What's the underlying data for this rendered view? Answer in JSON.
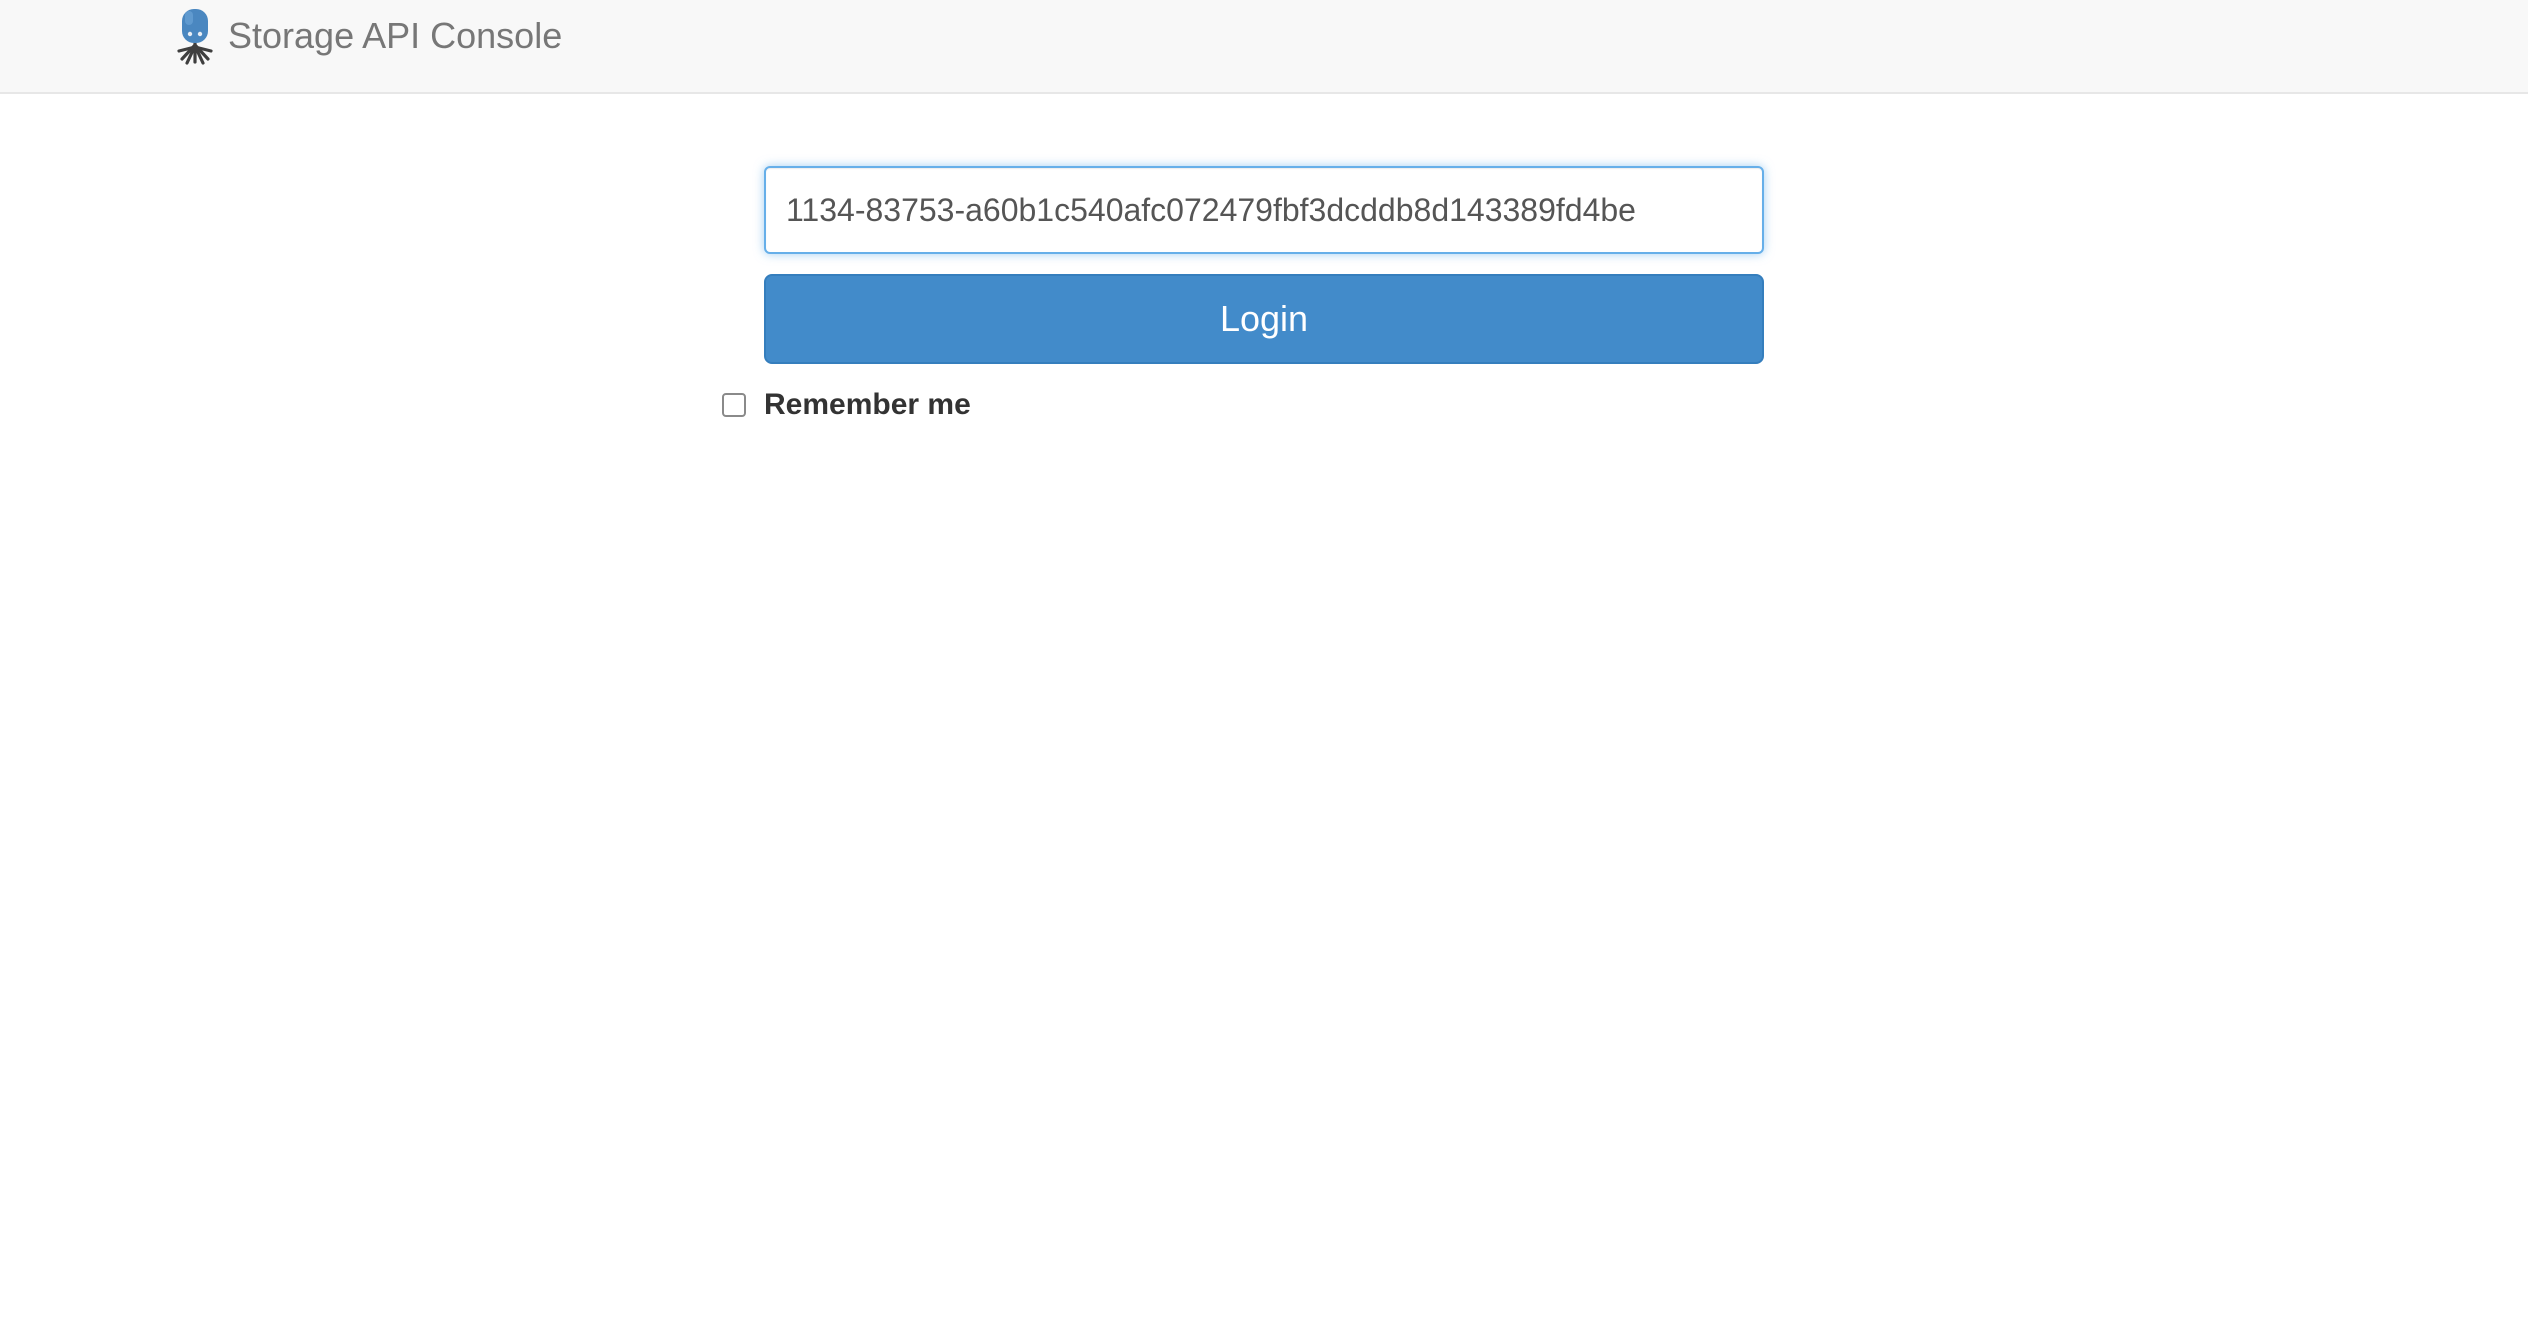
{
  "header": {
    "brand_title": "Storage API Console",
    "logo_icon": "octopus-icon"
  },
  "login_form": {
    "token_value": "1134-83753-a60b1c540afc072479fbf3dcddb8d143389fd4be",
    "login_label": "Login",
    "remember_label": "Remember me",
    "remember_checked": false
  },
  "colors": {
    "navbar_bg": "#f8f8f8",
    "primary_button": "#428bca",
    "input_focus_border": "#66afe9"
  }
}
